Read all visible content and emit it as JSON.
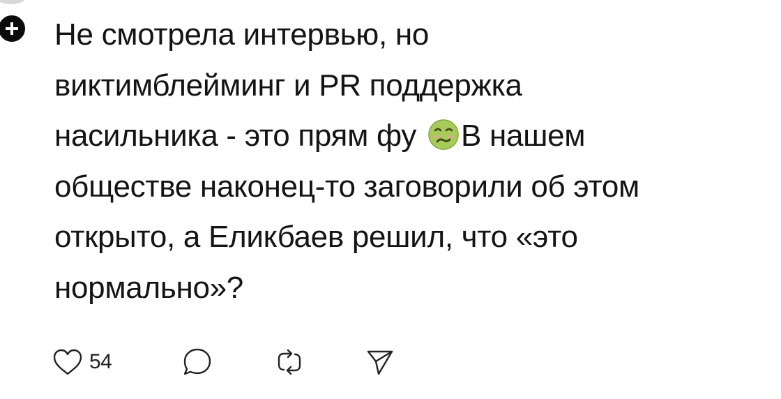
{
  "post": {
    "lines": [
      "Не смотрела интервью, но",
      "виктимблейминг и PR поддержка",
      "насильника - это прям фу",
      "В нашем",
      "обществе наконец-то заговорили об этом",
      "открыто, а Еликбаев решил, что «это",
      "нормально»?"
    ],
    "emoji": "nauseated-face-icon"
  },
  "actions": {
    "like_count": "54",
    "icons": [
      "heart-icon",
      "comment-icon",
      "repost-icon",
      "share-icon"
    ]
  },
  "colors": {
    "text": "#141414",
    "badge": "#0b0b0b",
    "emoji_face": "#9bc34a"
  }
}
